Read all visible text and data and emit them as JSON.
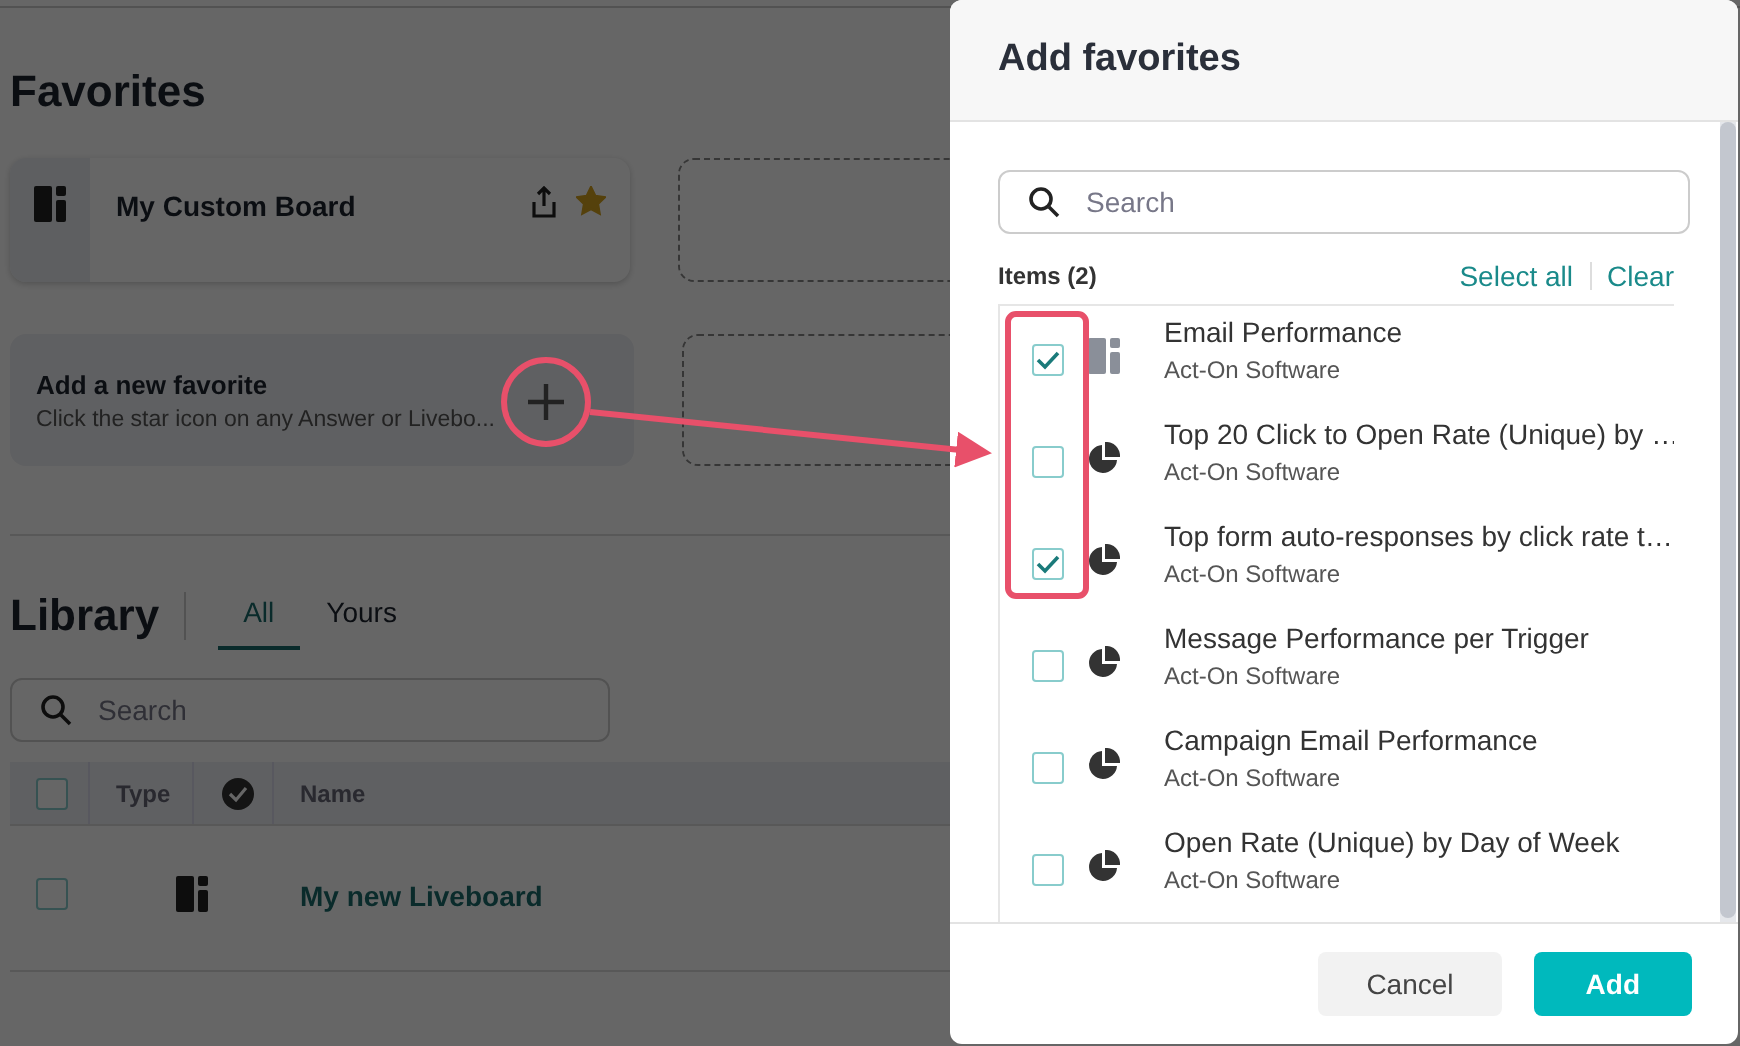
{
  "favorites": {
    "title": "Favorites",
    "cards": [
      {
        "kind": "board",
        "title": "My Custom Board",
        "starred": true
      }
    ],
    "add_card": {
      "title": "Add a new favorite",
      "text": "Click the star icon on any Answer or Livebo..."
    }
  },
  "library": {
    "title": "Library",
    "tabs": [
      {
        "label": "All",
        "selected": true
      },
      {
        "label": "Yours",
        "selected": false
      }
    ],
    "search": {
      "placeholder": "Search"
    },
    "columns": [
      "Type",
      "Name"
    ],
    "all_checked": false,
    "rows": [
      {
        "kind": "board",
        "name": "My new Liveboard",
        "checked": false
      }
    ]
  },
  "dialog": {
    "title": "Add favorites",
    "search": {
      "placeholder": "Search"
    },
    "count": "Items (2)",
    "select_all": "Select all",
    "clear": "Clear",
    "items": [
      {
        "kind": "board",
        "title": "Email Performance",
        "owner": "Act-On Software",
        "checked": true
      },
      {
        "kind": "chart",
        "title": "Top 20 Click to Open Rate (Unique) by …",
        "owner": "Act-On Software",
        "checked": false
      },
      {
        "kind": "chart",
        "title": "Top form auto-responses by click rate t…",
        "owner": "Act-On Software",
        "checked": true
      },
      {
        "kind": "chart",
        "title": "Message Performance per Trigger",
        "owner": "Act-On Software",
        "checked": false
      },
      {
        "kind": "chart",
        "title": "Campaign Email Performance",
        "owner": "Act-On Software",
        "checked": false
      },
      {
        "kind": "chart",
        "title": "Open Rate (Unique) by Day of Week",
        "owner": "Act-On Software",
        "checked": false
      }
    ],
    "buttons": [
      {
        "kind": "secondary",
        "label": "Cancel"
      },
      {
        "kind": "primary",
        "label": "Add"
      }
    ]
  }
}
